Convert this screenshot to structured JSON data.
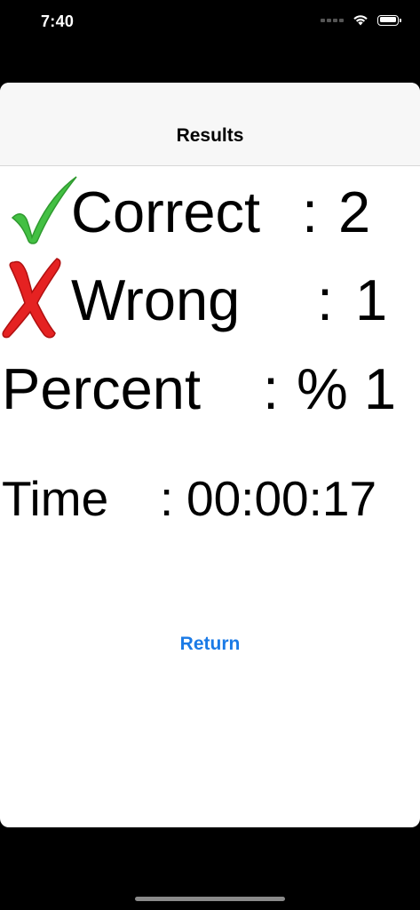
{
  "status_bar": {
    "time": "7:40",
    "icons": [
      "signal-dots-icon",
      "wifi-icon",
      "battery-icon"
    ]
  },
  "nav": {
    "title": "Results"
  },
  "results": {
    "correct": {
      "label": "Correct",
      "colon": ":",
      "value": "2",
      "icon": "check-mark-icon",
      "icon_color": "#3cb83c"
    },
    "wrong": {
      "label": "Wrong",
      "colon": ":",
      "value": "1",
      "icon": "cross-mark-icon",
      "icon_color": "#e02020"
    },
    "percent": {
      "label": "Percent",
      "colon": ":",
      "value": "% 1"
    },
    "time": {
      "label": "Time",
      "colon": ":",
      "value": "00:00:17"
    }
  },
  "actions": {
    "return_label": "Return"
  },
  "colors": {
    "accent": "#1a7ae6",
    "background": "#000000",
    "card": "#ffffff"
  }
}
